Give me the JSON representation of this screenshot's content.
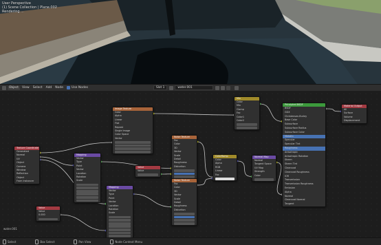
{
  "viewport": {
    "overlay_lines": [
      "User Perspective",
      "(1) Scene Collection | Plane.002",
      "Rendering ..."
    ]
  },
  "header": {
    "editor_type_icon": "node-editor-icon",
    "object_label": "Object",
    "menus": [
      "View",
      "Select",
      "Add",
      "Node"
    ],
    "use_nodes_label": "Use Nodes",
    "slot_label": "Slot 1",
    "material_name": "water.001"
  },
  "editor": {
    "label": "water.001"
  },
  "nodes": [
    {
      "id": "texcoord",
      "title": "Texture Coordinate",
      "color": "#a33a42",
      "rows": [
        "Generated",
        "Normal",
        "UV",
        "Object",
        "Camera",
        "Window",
        "Reflection",
        "Object",
        "From Instancer"
      ]
    },
    {
      "id": "mapping1",
      "title": "Mapping",
      "color": "#6a4aa3",
      "rows": [
        "Vector",
        "Type",
        "Point",
        "Vector",
        "Location",
        "Rotation",
        "Scale"
      ]
    },
    {
      "id": "image",
      "title": "Image Texture",
      "color": "#a8643a",
      "rows": [
        "Color",
        "Alpha",
        "Linear",
        "Flat",
        "Repeat",
        "Single Image",
        "Color Space",
        "Vector"
      ]
    },
    {
      "id": "value1",
      "title": "Value",
      "color": "#a33a42",
      "rows": [
        "Value",
        "0.000"
      ]
    },
    {
      "id": "mapping2",
      "title": "Mapping",
      "color": "#6a4aa3",
      "rows": [
        "Vector",
        "Type",
        "Point",
        "Vector",
        "Location",
        "Rotation",
        "Scale"
      ]
    },
    {
      "id": "noise1",
      "title": "Noise Texture",
      "color": "#a8643a",
      "rows": [
        "Fac",
        "Color",
        "3D",
        "Vector",
        "Scale",
        "Detail",
        "Roughness",
        "Distortion"
      ]
    },
    {
      "id": "value2",
      "title": "Value",
      "color": "#a33a42",
      "rows": [
        "Value"
      ]
    },
    {
      "id": "noise2",
      "title": "Noise Texture",
      "color": "#a8643a",
      "rows": [
        "Fac",
        "Color",
        "3D",
        "Vector",
        "Scale",
        "Detail",
        "Roughness",
        "Distortion"
      ]
    },
    {
      "id": "colorramp",
      "title": "ColorRamp",
      "color": "#a08a2a",
      "rows": [
        "Color",
        "Alpha",
        "RGB",
        "Linear",
        "Fac"
      ]
    },
    {
      "id": "mix",
      "title": "Mix",
      "color": "#a08a2a",
      "rows": [
        "Color",
        "Mix",
        "Clamp",
        "Fac",
        "Color1",
        "Color2"
      ]
    },
    {
      "id": "bump",
      "title": "Normal Map",
      "color": "#6a4aa3",
      "rows": [
        "Normal",
        "Tangent Space",
        "UV Map",
        "Strength",
        "Color"
      ]
    },
    {
      "id": "bsdf",
      "title": "Principled BSDF",
      "color": "#3c9a3c",
      "rows": [
        "BSDF",
        "GGX",
        "Christensen-Burley",
        "Base Color",
        "Subsurface",
        "Subsurface Radius",
        "Subsurface Color",
        "Metallic",
        "Specular",
        "Specular Tint",
        "Roughness",
        "Anisotropic",
        "Anisotropic Rotation",
        "Sheen",
        "Sheen Tint",
        "Clearcoat",
        "Clearcoat Roughness",
        "IOR",
        "Transmission",
        "Transmission Roughness",
        "Emission",
        "Alpha",
        "Normal",
        "Clearcoat Normal",
        "Tangent"
      ]
    },
    {
      "id": "output",
      "title": "Material Output",
      "color": "#a33a42",
      "rows": [
        "All",
        "Surface",
        "Volume",
        "Displacement"
      ]
    }
  ],
  "status": {
    "items": [
      "Select",
      "Box Select",
      "Pan View",
      "Node Context Menu"
    ]
  },
  "colors": {
    "accent_blue": "#4772b3",
    "socket_yellow": "#c7c729",
    "socket_grey": "#a1a1a1",
    "socket_purple": "#6363c7",
    "socket_green": "#63c763"
  }
}
